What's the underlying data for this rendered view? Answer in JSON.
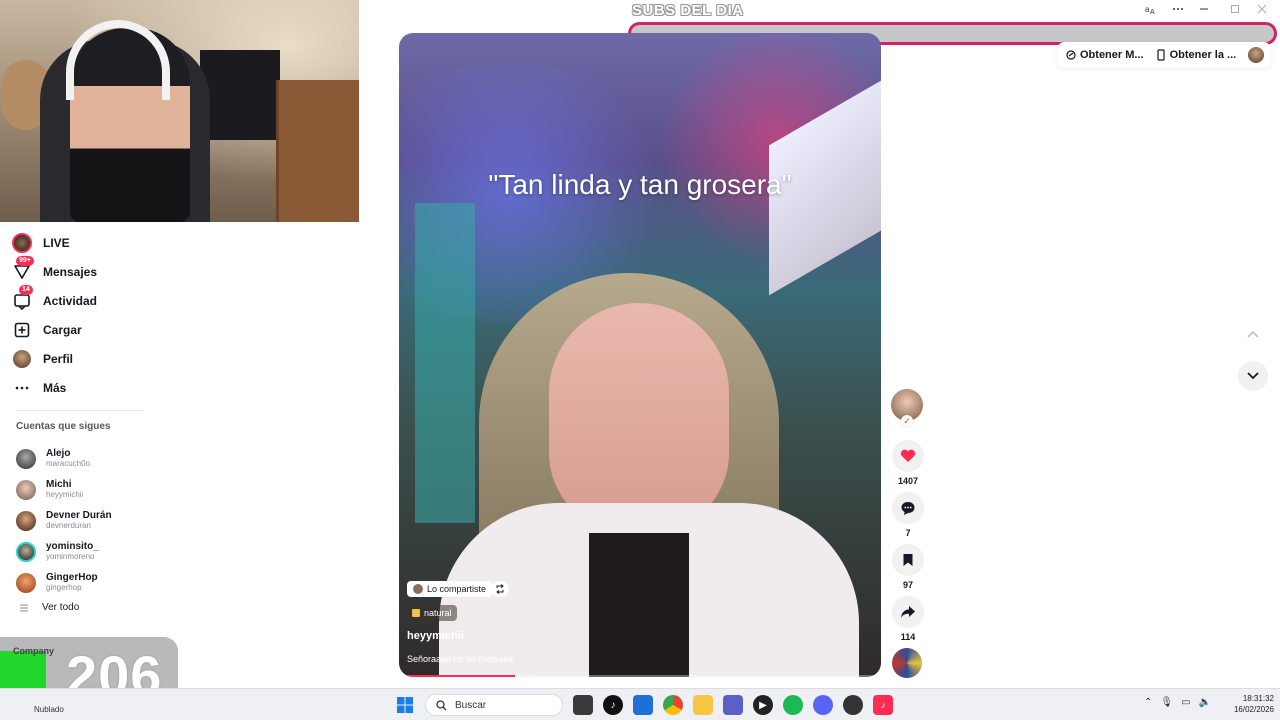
{
  "overlay": {
    "subs_label": "SUBS DEL DIA",
    "counter_value": "206",
    "company_text": "Company"
  },
  "window": {
    "translate_icon": "translate-icon",
    "more_icon": "ellipsis-icon",
    "minimize_icon": "minimize-icon"
  },
  "top_actions": {
    "get_app_label": "Obtener M...",
    "get_desktop_label": "Obtener la ..."
  },
  "nav": {
    "items": [
      {
        "label": "LIVE",
        "icon": "live-avatar-icon"
      },
      {
        "label": "Mensajes",
        "icon": "messages-icon",
        "badge": "99+"
      },
      {
        "label": "Actividad",
        "icon": "activity-icon",
        "badge": "14"
      },
      {
        "label": "Cargar",
        "icon": "upload-icon"
      },
      {
        "label": "Perfil",
        "icon": "profile-avatar-icon"
      },
      {
        "label": "Más",
        "icon": "more-icon"
      }
    ]
  },
  "following": {
    "title": "Cuentas que sigues",
    "accounts": [
      {
        "name": "Alejo",
        "username": "maracuch0o"
      },
      {
        "name": "Michi",
        "username": "heyymichii"
      },
      {
        "name": "Devner Durán",
        "username": "devnerduran"
      },
      {
        "name": "yominsito_",
        "username": "yominmoreno"
      },
      {
        "name": "GingerHop",
        "username": "gingerhop"
      }
    ],
    "see_all": "Ver todo"
  },
  "video": {
    "caption_overlay": "\"Tan linda y tan grosera\"",
    "shared_label": "Lo compartiste",
    "tag_label": "natural",
    "author": "heyymichii",
    "description": "Señoraaaa no se metaaaa",
    "progress": 0.24
  },
  "actions": {
    "likes": "1407",
    "comments": "7",
    "saves": "97",
    "shares": "114"
  },
  "taskbar": {
    "weather": "Nublado",
    "search_placeholder": "Buscar",
    "time": "18:31:32",
    "date": "16/02/2026"
  },
  "colors": {
    "accent": "#fe2c55",
    "subs_border": "#d61f69",
    "counter_logo": "#22d62b"
  }
}
